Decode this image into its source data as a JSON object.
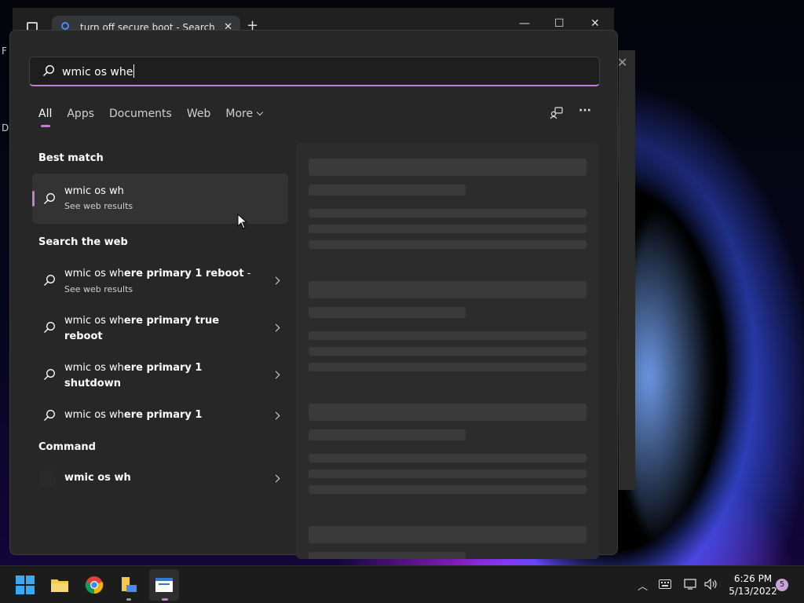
{
  "browser": {
    "tab_title": "turn off secure boot - Search",
    "tab_close": "✕",
    "new_tab": "+",
    "minimize": "—",
    "maximize": "☐",
    "close": "✕"
  },
  "background_window": {
    "close": "✕"
  },
  "edge_text": {
    "f": "F",
    "da": "Da"
  },
  "search": {
    "query": "wmic os whe"
  },
  "filters": {
    "all": "All",
    "apps": "Apps",
    "documents": "Documents",
    "web": "Web",
    "more": "More"
  },
  "more_options": "···",
  "sections": {
    "best_match": "Best match",
    "search_web": "Search the web",
    "command": "Command"
  },
  "best_match": {
    "title": "wmic os wh",
    "subtitle": "See web results"
  },
  "web_results": [
    {
      "prefix": "wmic os wh",
      "bold": "ere primary 1 reboot",
      "suffix": " -",
      "subtitle": "See web results"
    },
    {
      "prefix": "wmic os wh",
      "bold": "ere primary true",
      "line2": "reboot"
    },
    {
      "prefix": "wmic os wh",
      "bold": "ere primary 1",
      "line2": "shutdown"
    },
    {
      "prefix": "wmic os wh",
      "bold": "ere primary 1"
    }
  ],
  "command": {
    "title": "wmic os wh"
  },
  "taskbar": {
    "time": "6:26 PM",
    "date": "5/13/2022",
    "notification_count": "5",
    "colors": {
      "accent": "#c57cd8",
      "start_blue": "#3aa8f3"
    }
  }
}
